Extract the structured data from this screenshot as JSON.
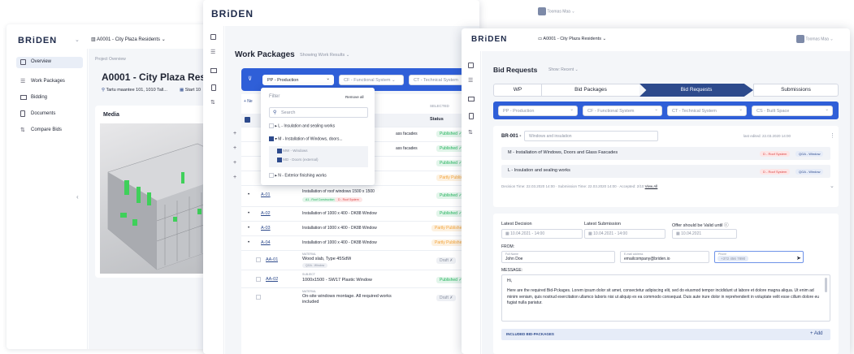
{
  "win1": {
    "brand": "BRiDEN",
    "project_selector": "A0001 - City Plaza Residents",
    "nav": [
      {
        "label": "Overview",
        "icon": "overview-icon"
      },
      {
        "label": "Work Packages",
        "icon": "list-icon"
      },
      {
        "label": "Bidding",
        "icon": "bidding-icon"
      },
      {
        "label": "Documents",
        "icon": "document-icon"
      },
      {
        "label": "Compare Bids",
        "icon": "compare-icon"
      }
    ],
    "breadcrumb": "Project Overview",
    "title": "A0001 - City Plaza Reside",
    "address": "Tartu maantee 101, 1010 Tall...",
    "start": "Start 10",
    "media_title": "Media"
  },
  "win2": {
    "brand": "BRiDEN",
    "user": "Toomas Maa",
    "title": "Work Packages",
    "showing": "Showing Work Results",
    "filter_chip": "PP - Production",
    "filter_functional": "CF - Functional System",
    "filter_technical": "CT - Technical System",
    "filter_header": "Filter",
    "remove_all": "Remove all",
    "search_placeholder": "Search",
    "tree": [
      "L - Insulation and sealing works",
      "M - Installation of Windows, doors...",
      "MW - Windows",
      "MD - Doors (external)",
      "N - Exterior finishing works"
    ],
    "col_status": "Status",
    "col_selected": "SELECTED",
    "add_label": "+ Ne",
    "peek_rows": [
      {
        "desc": "ass facades",
        "status": "Published ✓"
      },
      {
        "desc": "ass facades",
        "status": "Published ✓"
      },
      {
        "desc": "",
        "status": "Published ✓"
      },
      {
        "desc": "",
        "status": "Partly Published ✗"
      }
    ],
    "rows": [
      {
        "code": "A-01",
        "desc": "Installation of roof windows 1500 x 1500",
        "tags": [
          "A1 - Roof Construction",
          "D - Roof System"
        ],
        "status": "Published ✓"
      },
      {
        "code": "A-02",
        "desc": "Installation of 1000 x 400 - DK88 Window",
        "tags": [],
        "status": "Published ✓"
      },
      {
        "code": "A-03",
        "desc": "Installation of 1000 x 400 - DK88 Window",
        "tags": [],
        "status": "Partly Published ✗"
      },
      {
        "code": "A-04",
        "desc": "Installation of 1000 x 400 - DK88 Window",
        "tags": [],
        "status": "Partly Published ✗"
      },
      {
        "code": "AA-01",
        "kind": "MATERIAL",
        "desc": "Wood slab, Type 45SdW",
        "tags": [
          "QGA - Window"
        ],
        "status": "Draft ✗"
      },
      {
        "code": "AA-02",
        "kind": "SUBJECT",
        "desc": "1000x1500 - SW17 Plastic Window",
        "tags": [],
        "status": "Published ✓"
      },
      {
        "code": "",
        "kind": "MATERIAL",
        "desc": "On-site windows montage. All required works included",
        "tags": [],
        "status": "Draft ✗"
      }
    ]
  },
  "win3": {
    "brand": "BRiDEN",
    "project_selector": "A0001 - City Plaza Residents",
    "user": "Toomas Maa",
    "title": "Bid Requests",
    "show": "Show: Recent",
    "steps": [
      "WP",
      "Bid Packages",
      "Bid Requests",
      "Submissions"
    ],
    "filters": [
      "PP - Production",
      "CF - Functional System",
      "CT - Technical System",
      "CS - Built Space"
    ],
    "request_code": "BR-001 -",
    "request_name": "Windows and insulation",
    "last_edited": "last edited: 22.03.2020 14:00",
    "packages": [
      {
        "name": "M - Installation of Windows, Doors and Glass Fascades",
        "tags": [
          "D - Roof System",
          "QGA - Window"
        ]
      },
      {
        "name": "L - Insulation and sealing works",
        "tags": [
          "D - Roof System",
          "QGA - Window"
        ]
      }
    ],
    "meta": "Decision Time: 22.03.2020 14:00 · Submission Time: 22.03.2020 14:00 · Accepted: 2/10",
    "view_all": "View All",
    "latest_decision_label": "Latest Decision",
    "latest_decision": "10.04.2021 - 14:00",
    "latest_submission_label": "Latest Submission",
    "latest_submission": "10.04.2021 - 14:00",
    "valid_label": "Offer should be Valid until",
    "valid_until": "10.04.2021",
    "from_label": "FROM:",
    "name_label": "Full Name",
    "name_value": "John Doe",
    "email_label": "E-mail address",
    "email_value": "emailcompany@briden.io",
    "phone_label": "Phone",
    "phone_value": "+372 456 7890",
    "message_label": "MESSAGE:",
    "message_greeting": "Hi,",
    "message_body": "Here are the required Bid-Pckages. Lorem ipsum dolor sit amet, consectetur adipiscing elit, sed do eiusmod tempor incididunt ut labore et dolore magna aliqua. Ut enim ad minim veniam, quis nostrud exercitation ullamco laboris nisi ut aliquip ex ea commodo consequat. Duis aute irure dolor in reprehenderit in voluptate velit esse cillum dolore eu fugiat nulla pariatur.",
    "included_label": "INCLUDED BID-PACKAGES",
    "add_label": "+ Add"
  },
  "colors": {
    "accent": "#2f5fd8",
    "green": "#23b35c",
    "orange": "#f2a33a",
    "navy": "#2d4a8c"
  }
}
